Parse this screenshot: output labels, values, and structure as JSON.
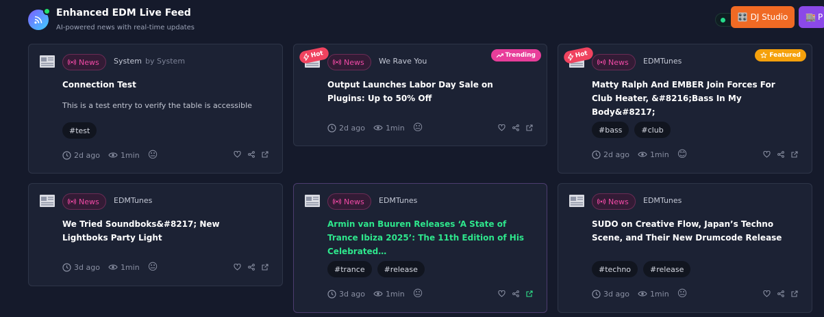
{
  "header": {
    "title": "Enhanced EDM Live Feed",
    "subtitle": "AI-powered news with real-time updates",
    "dj_button": "DJ Studio",
    "purple_button": "P"
  },
  "colors": {
    "background": "#151a2b",
    "card": "#1c2234",
    "news_badge": "#f24aa6",
    "hot": "#f0435f",
    "trending": "#e83e9a",
    "featured": "#f5a10c",
    "highlight_title": "#2ee68c"
  },
  "labels": {
    "news": "News",
    "hot": "Hot",
    "trending": "Trending",
    "featured": "Featured"
  },
  "cards": [
    {
      "source": "System",
      "byline": "by System",
      "title": "Connection Test",
      "description": "This is a test entry to verify the table is accessible",
      "tags": [
        "#test"
      ],
      "time": "2d ago",
      "read": "1min",
      "emoji": "😐"
    },
    {
      "source": "We Rave You",
      "title": "Output Launches Labor Day Sale on Plugins: Up to 50% Off",
      "tags": [],
      "time": "2d ago",
      "read": "1min",
      "emoji": "😐",
      "hot": true,
      "trending": true
    },
    {
      "source": "EDMTunes",
      "title": "Matty Ralph And EMBER Join Forces For Club Heater, &#8216;Bass In My Body&#8217;",
      "tags": [
        "#bass",
        "#club"
      ],
      "time": "2d ago",
      "read": "1min",
      "emoji": "😊",
      "hot": true,
      "featured": true
    },
    {
      "source": "EDMTunes",
      "title": "We Tried Soundboks&#8217; New Lightboks Party Light",
      "tags": [],
      "time": "3d ago",
      "read": "1min",
      "emoji": "😐"
    },
    {
      "source": "EDMTunes",
      "title": "Armin van Buuren Releases ‘A State of Trance Ibiza 2025’: The 11th Edition of His Celebrated…",
      "tags": [
        "#trance",
        "#release"
      ],
      "time": "3d ago",
      "read": "1min",
      "emoji": "😐"
    },
    {
      "source": "EDMTunes",
      "title": "SUDO on Creative Flow, Japan’s Techno Scene, and Their New Drumcode Release",
      "tags": [
        "#techno",
        "#release"
      ],
      "time": "3d ago",
      "read": "1min",
      "emoji": "😐"
    }
  ]
}
